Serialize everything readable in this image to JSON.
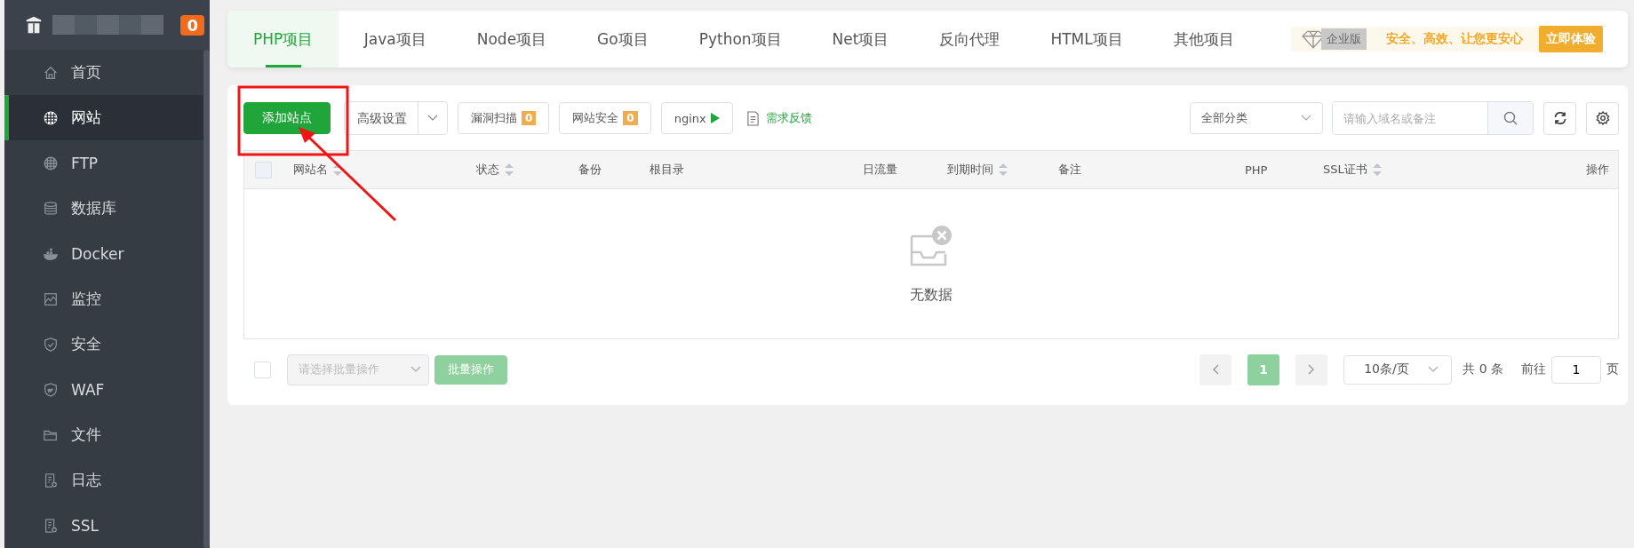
{
  "sidebar": {
    "badge": "0",
    "items": [
      {
        "label": "首页",
        "selected": false
      },
      {
        "label": "网站",
        "selected": true
      },
      {
        "label": "FTP",
        "selected": false
      },
      {
        "label": "数据库",
        "selected": false
      },
      {
        "label": "Docker",
        "selected": false
      },
      {
        "label": "监控",
        "selected": false
      },
      {
        "label": "安全",
        "selected": false
      },
      {
        "label": "WAF",
        "selected": false
      },
      {
        "label": "文件",
        "selected": false
      },
      {
        "label": "日志",
        "selected": false
      },
      {
        "label": "SSL",
        "selected": false
      }
    ]
  },
  "tabs": [
    {
      "label": "PHP项目",
      "selected": true
    },
    {
      "label": "Java项目",
      "selected": false
    },
    {
      "label": "Node项目",
      "selected": false
    },
    {
      "label": "Go项目",
      "selected": false
    },
    {
      "label": "Python项目",
      "selected": false
    },
    {
      "label": "Net项目",
      "selected": false
    },
    {
      "label": "反向代理",
      "selected": false
    },
    {
      "label": "HTML项目",
      "selected": false
    },
    {
      "label": "其他项目",
      "selected": false
    }
  ],
  "promo": {
    "edition": "企业版",
    "slogan": "安全、高效、让您更安心",
    "button": "立即体验"
  },
  "toolbar": {
    "add_button": "添加站点",
    "advanced": "高级设置",
    "scan": {
      "label": "漏洞扫描",
      "count": "0"
    },
    "security": {
      "label": "网站安全",
      "count": "0"
    },
    "nginx": "nginx",
    "feedback": "需求反馈",
    "category": "全部分类",
    "search": {
      "placeholder": "请输入域名或备注"
    }
  },
  "table": {
    "header_checkbox": {
      "checked": false
    },
    "columns": [
      {
        "label": "网站名",
        "sortable": true
      },
      {
        "label": "状态",
        "sortable": true
      },
      {
        "label": "备份",
        "sortable": false
      },
      {
        "label": "根目录",
        "sortable": false
      },
      {
        "label": "日流量",
        "sortable": false
      },
      {
        "label": "到期时间",
        "sortable": true
      },
      {
        "label": "备注",
        "sortable": false
      },
      {
        "label": "PHP",
        "sortable": false
      },
      {
        "label": "SSL证书",
        "sortable": true
      },
      {
        "label": "操作",
        "sortable": false
      }
    ],
    "empty_text": "无数据"
  },
  "footer": {
    "checkbox": {
      "checked": false
    },
    "batch_select": {
      "placeholder": "请选择批量操作",
      "disabled": true
    },
    "batch_button": {
      "label": "批量操作",
      "disabled": true
    },
    "pagination": {
      "prev_disabled": true,
      "pages": [
        {
          "label": "1",
          "selected": true
        }
      ],
      "next_disabled": true,
      "page_size": "10条/页",
      "total": "共 0 条",
      "goto_label": "前往",
      "goto_value": "1",
      "page_suffix": "页"
    }
  }
}
